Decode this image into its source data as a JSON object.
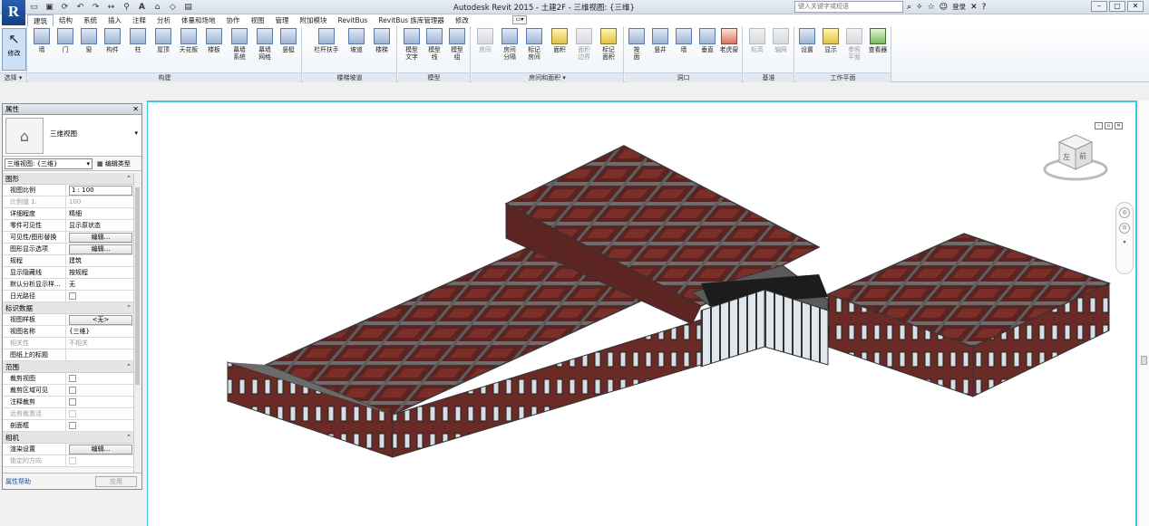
{
  "titlebar": {
    "title": "Autodesk Revit 2015 -   土建2F - 三维视图: {三维}",
    "search_placeholder": "键入关键字或短语",
    "login": "登录",
    "logo": "R",
    "qat_icons": [
      "open-icon",
      "save-icon",
      "sync-icon",
      "undo-icon",
      "redo-icon",
      "measure-icon",
      "tag-icon",
      "text-icon",
      "3d-icon",
      "section-icon",
      "switch-windows-icon"
    ]
  },
  "tabs": [
    "建筑",
    "结构",
    "系统",
    "插入",
    "注释",
    "分析",
    "体量和场地",
    "协作",
    "视图",
    "管理",
    "附加模块",
    "RevitBus",
    "RevitBus 族库管理器",
    "修改"
  ],
  "ribbon": {
    "modify": "修改",
    "select_label": "选择 ▾",
    "build_buttons": [
      "墙",
      "门",
      "窗",
      "构件",
      "柱",
      "屋顶",
      "天花板",
      "楼板",
      "幕墙\n系统",
      "幕墙\n网格",
      "竖梃"
    ],
    "build_label": "构建",
    "circulation_buttons": [
      "栏杆扶手",
      "坡道",
      "楼梯"
    ],
    "circulation_label": "楼梯坡道",
    "model_buttons": [
      "模型\n文字",
      "模型\n线",
      "模型\n组"
    ],
    "model_label": "模型",
    "room_buttons": [
      "房间",
      "房间\n分隔",
      "标记\n房间",
      "面积",
      "面积\n边界",
      "标记\n面积"
    ],
    "room_label": "房间和面积 ▾",
    "opening_buttons": [
      "按\n面",
      "竖井",
      "墙",
      "垂直",
      "老虎窗"
    ],
    "opening_label": "洞口",
    "datum_buttons": [
      "标高",
      "轴网"
    ],
    "datum_label": "基准",
    "workplane_buttons": [
      "设置",
      "显示",
      "参照\n平面",
      "查看器"
    ],
    "workplane_label": "工作平面"
  },
  "properties": {
    "title": "属性",
    "type_name": "三维视图",
    "instance": "三维视图: {三维}",
    "edit_type": "编辑类型",
    "groups": [
      {
        "name": "图形",
        "rows": [
          {
            "k": "视图比例",
            "v": "1 : 100",
            "kind": "box"
          },
          {
            "k": "比例值 1:",
            "v": "100",
            "kind": "text",
            "dim": true
          },
          {
            "k": "详细程度",
            "v": "精细",
            "kind": "text"
          },
          {
            "k": "零件可见性",
            "v": "显示原状态",
            "kind": "text"
          },
          {
            "k": "可见性/图形替换",
            "v": "编辑...",
            "kind": "button"
          },
          {
            "k": "图形显示选项",
            "v": "编辑...",
            "kind": "button"
          },
          {
            "k": "规程",
            "v": "建筑",
            "kind": "text"
          },
          {
            "k": "显示隐藏线",
            "v": "按规程",
            "kind": "text"
          },
          {
            "k": "默认分析显示样...",
            "v": "无",
            "kind": "text"
          },
          {
            "k": "日光路径",
            "v": "",
            "kind": "check",
            "dim": false
          }
        ]
      },
      {
        "name": "标识数据",
        "rows": [
          {
            "k": "视图样板",
            "v": "<无>",
            "kind": "button"
          },
          {
            "k": "视图名称",
            "v": "{三维}",
            "kind": "text"
          },
          {
            "k": "相关性",
            "v": "不相关",
            "kind": "text",
            "dim": true
          },
          {
            "k": "图纸上的标题",
            "v": "",
            "kind": "text"
          }
        ]
      },
      {
        "name": "范围",
        "rows": [
          {
            "k": "裁剪视图",
            "v": "",
            "kind": "check"
          },
          {
            "k": "裁剪区域可见",
            "v": "",
            "kind": "check"
          },
          {
            "k": "注释裁剪",
            "v": "",
            "kind": "check"
          },
          {
            "k": "远剪裁激活",
            "v": "",
            "kind": "check",
            "dim": true
          },
          {
            "k": "剖面框",
            "v": "",
            "kind": "check"
          }
        ]
      },
      {
        "name": "相机",
        "rows": [
          {
            "k": "渲染设置",
            "v": "编辑...",
            "kind": "button"
          },
          {
            "k": "锁定的方向",
            "v": "",
            "kind": "check",
            "dim": true
          }
        ]
      }
    ],
    "help": "属性帮助",
    "apply": "应用"
  },
  "viewcube": {
    "left": "左",
    "front": "前"
  },
  "colors": {
    "accent": "#3cc8dc",
    "brick": "#7a2b26",
    "concrete": "#6b6b6b"
  }
}
